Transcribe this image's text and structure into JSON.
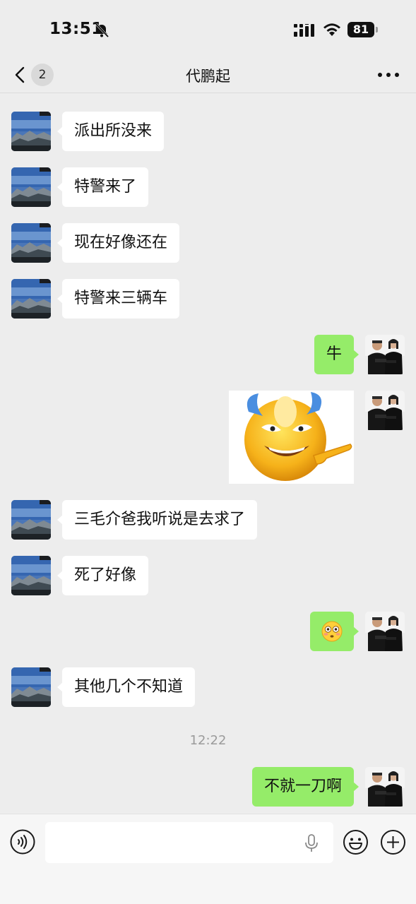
{
  "status_bar": {
    "time": "13:51",
    "battery": "81"
  },
  "nav": {
    "unread_count": "2",
    "title": "代鹏起"
  },
  "messages": [
    {
      "side": "left",
      "text": "派出所没来"
    },
    {
      "side": "left",
      "text": "特警来了"
    },
    {
      "side": "left",
      "text": "现在好像还在"
    },
    {
      "side": "left",
      "text": "特警来三辆车"
    },
    {
      "side": "right",
      "text": "牛"
    },
    {
      "side": "right",
      "type": "sticker",
      "icon": "pointing-emoji-sticker"
    },
    {
      "side": "left",
      "text": "三毛介爸我听说是去求了"
    },
    {
      "side": "left",
      "text": "死了好像"
    },
    {
      "side": "right",
      "type": "emoji",
      "icon": "flushed-face-emoji"
    },
    {
      "side": "left",
      "text": "其他几个不知道"
    },
    {
      "side": "right",
      "text": "不就一刀啊"
    }
  ],
  "timestamp": "12:22",
  "colors": {
    "background": "#ededed",
    "incoming_bubble": "#ffffff",
    "outgoing_bubble": "#95ec69",
    "timestamp": "#9b9b9b"
  }
}
